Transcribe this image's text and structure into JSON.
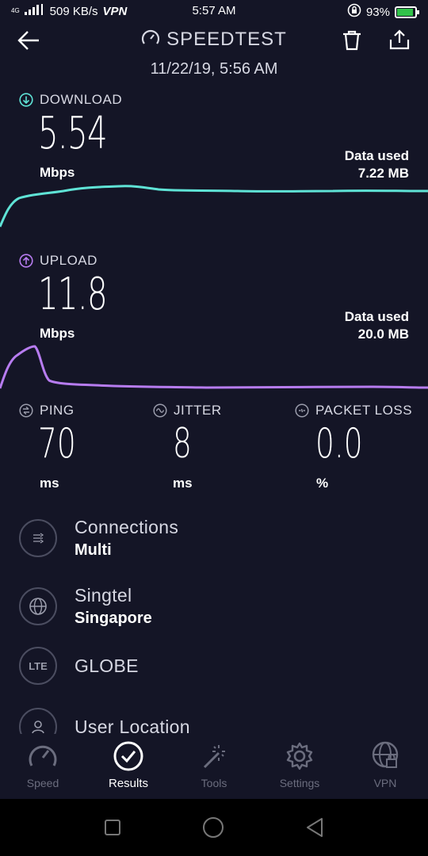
{
  "status_bar": {
    "network_type": "4G",
    "speed": "509 KB/s",
    "vpn": "VPN",
    "time": "5:57 AM",
    "battery": "93%",
    "battery_level": 0.93
  },
  "header": {
    "title": "SPEEDTEST",
    "date": "11/22/19, 5:56 AM"
  },
  "download": {
    "label": "DOWNLOAD",
    "value": "5.54",
    "unit": "Mbps",
    "data_used_label": "Data used",
    "data_used_value": "7.22 MB",
    "color": "#5fe3d6"
  },
  "upload": {
    "label": "UPLOAD",
    "value": "11.8",
    "unit": "Mbps",
    "data_used_label": "Data used",
    "data_used_value": "20.0 MB",
    "color": "#b77cf0"
  },
  "stats": {
    "ping": {
      "label": "PING",
      "value": "70",
      "unit": "ms"
    },
    "jitter": {
      "label": "JITTER",
      "value": "8",
      "unit": "ms"
    },
    "packet_loss": {
      "label": "PACKET LOSS",
      "value": "0.0",
      "unit": "%"
    }
  },
  "info": {
    "connections": {
      "title": "Connections",
      "value": "Multi"
    },
    "server": {
      "title": "Singtel",
      "value": "Singapore"
    },
    "provider": {
      "icon_text": "LTE",
      "title": "GLOBE"
    },
    "location": {
      "title": "User Location"
    }
  },
  "nav": {
    "speed": "Speed",
    "results": "Results",
    "tools": "Tools",
    "settings": "Settings",
    "vpn": "VPN"
  }
}
